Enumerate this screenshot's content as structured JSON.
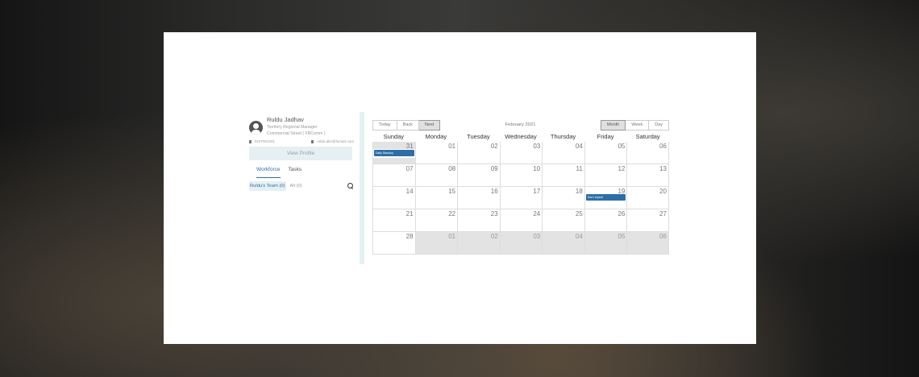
{
  "user": {
    "name": "Ruldu Jadhav",
    "role": "Territory Regional Manager",
    "location": "Commercial Street ( FBComm )",
    "phone": "9107001201",
    "email": "ruldu.abc@fumart.com",
    "view_profile": "View Profile"
  },
  "tabs": {
    "workforce": "Workforce",
    "tasks": "Tasks"
  },
  "filters": {
    "team": "Ruldu's Team (0)",
    "all": "All (0)"
  },
  "calendar": {
    "today": "Today",
    "back": "Back",
    "next": "Next",
    "title": "February 2021",
    "month": "Month",
    "week": "Week",
    "day": "Day",
    "days_of_week": [
      "Sunday",
      "Monday",
      "Tuesday",
      "Wednesday",
      "Thursday",
      "Friday",
      "Saturday"
    ],
    "weeks": [
      [
        "31",
        "01",
        "02",
        "03",
        "04",
        "05",
        "06"
      ],
      [
        "07",
        "08",
        "09",
        "10",
        "11",
        "12",
        "13"
      ],
      [
        "14",
        "15",
        "16",
        "17",
        "18",
        "19",
        "20"
      ],
      [
        "21",
        "22",
        "23",
        "24",
        "25",
        "26",
        "27"
      ],
      [
        "28",
        "01",
        "02",
        "03",
        "04",
        "05",
        "06"
      ]
    ],
    "events": {
      "daily_standup": "Daily Standup",
      "dont_repeat": "Don't repeat"
    }
  },
  "colors": {
    "accent": "#2e6ea8",
    "light": "#e6f0f2",
    "offrange": "#e3e3e3"
  }
}
